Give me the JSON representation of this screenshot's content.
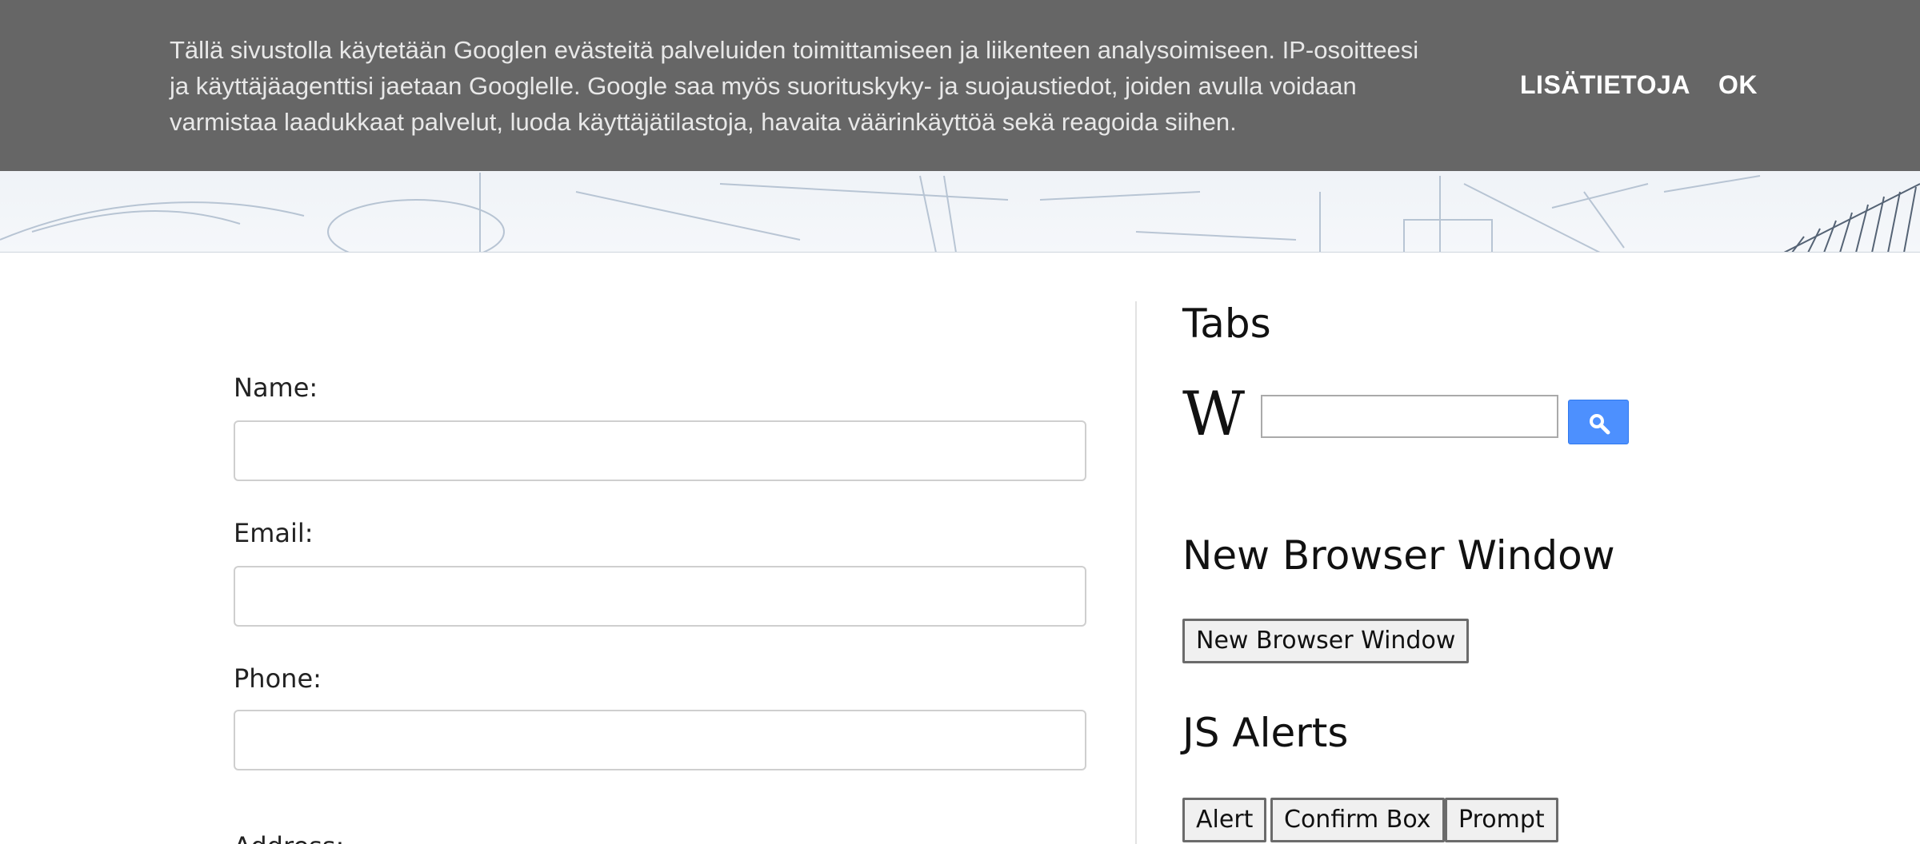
{
  "cookie_bar": {
    "text": "Tällä sivustolla käytetään Googlen evästeitä palveluiden toimittamiseen ja liikenteen analysoimiseen. IP-osoitteesi ja käyttäjäagenttisi jaetaan Googlelle. Google saa myös suorituskyky- ja suojaustiedot, joiden avulla voidaan varmistaa laadukkaat palvelut, luoda käyttäjätilastoja, havaita väärinkäyttöä sekä reagoida siihen.",
    "more_label": "LISÄTIETOJA",
    "ok_label": "OK"
  },
  "form": {
    "name_label": "Name:",
    "email_label": "Email:",
    "phone_label": "Phone:",
    "address_label": "Address:"
  },
  "sidebar": {
    "tabs_title": "Tabs",
    "wiki_logo": "W",
    "new_window_title": "New Browser Window",
    "new_window_button": "New Browser Window",
    "js_alerts_title": "JS Alerts",
    "alert_button": "Alert",
    "confirm_button": "Confirm Box",
    "prompt_button": "Prompt"
  },
  "colors": {
    "cookie_bg": "#666666",
    "search_btn": "#4d90fe"
  },
  "icons": {
    "search": "search-icon"
  }
}
